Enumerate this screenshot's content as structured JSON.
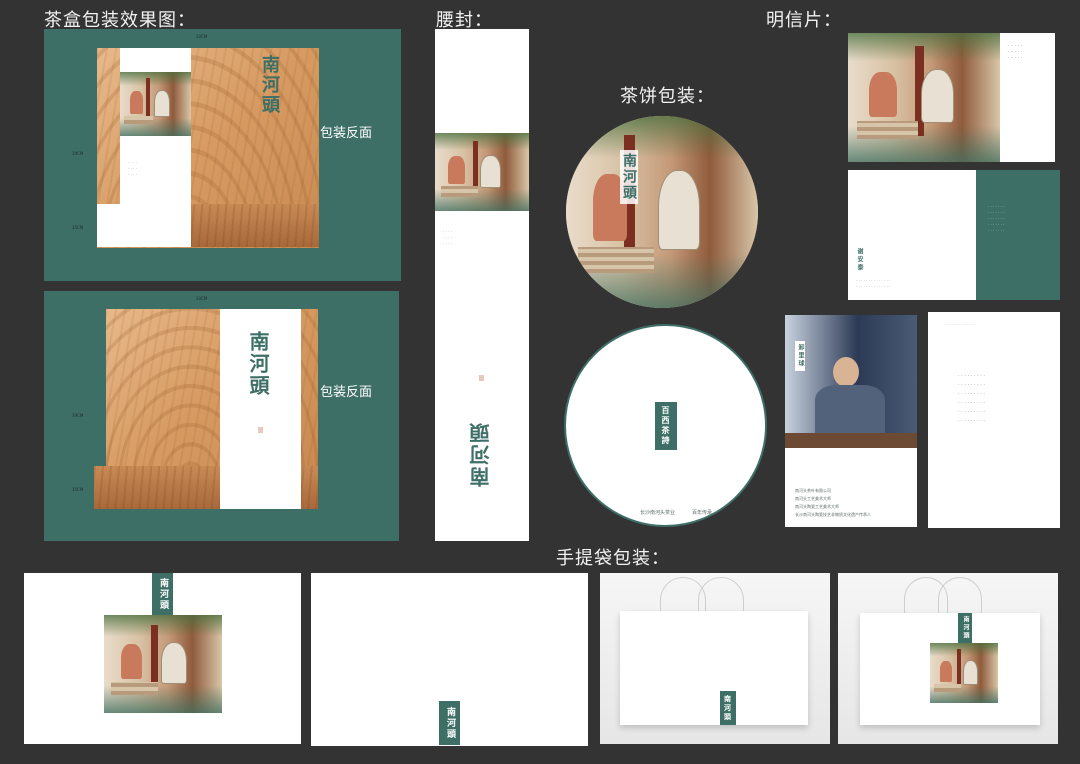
{
  "titles": {
    "tea_box": "茶盒包装效果图：",
    "waist_seal": "腰封：",
    "postcard": "明信片：",
    "tea_cake": "茶饼包装：",
    "handbag": "手提袋包装："
  },
  "brand": {
    "logo_text": "南河頭",
    "package_back": "包装反面",
    "cake_logo": "百西茶詩",
    "postcard_header": "南河頭",
    "postcard_name": "谢安泰"
  },
  "colors": {
    "background": "#333333",
    "brand_green": "#3e6f67",
    "wood": "#d79b62",
    "white": "#ffffff",
    "seal_red": "#c35c4a"
  },
  "dimensions": {
    "box1_width": "20CM",
    "box1_height": "19CM",
    "box1_depth": "15CM",
    "box2_width": "20CM",
    "box2_height": "19CM",
    "box2_depth": "15CM"
  },
  "postcard": {
    "artisan_name": "卸里球",
    "credits": [
      "南河头茶叶有限公司",
      "南河头工艺美术大师",
      "南河头陶瓷工艺美术大师",
      "长沙南河头陶瓷技艺非物质文化遗产传承人"
    ],
    "cake_bottom_left": "长沙南河头茶业",
    "cake_bottom_right": "百年传承"
  },
  "icons": [
    "illustration",
    "seal-stamp",
    "bag-handle"
  ]
}
